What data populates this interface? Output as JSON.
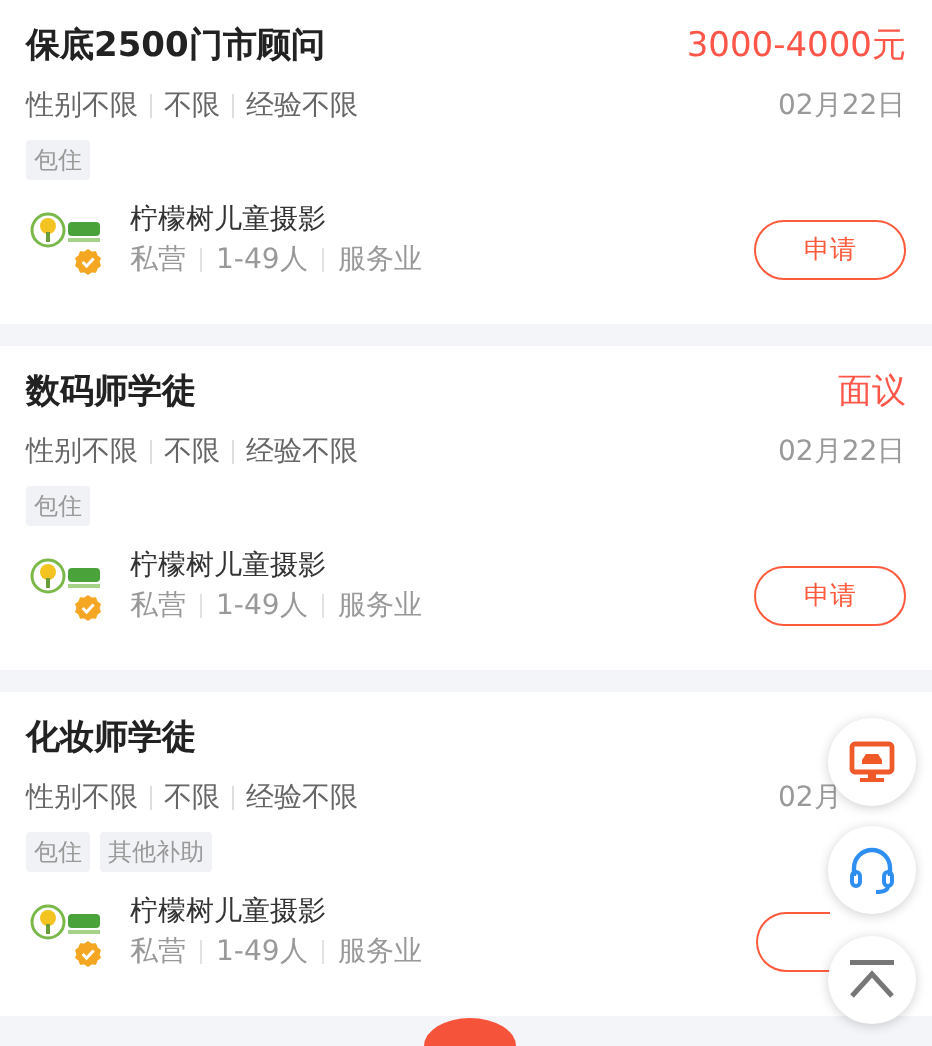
{
  "jobs": [
    {
      "title": "保底2500门市顾问",
      "salary": "3000-4000元",
      "requirements": [
        "性别不限",
        "不限",
        "经验不限"
      ],
      "date": "02月22日",
      "tags": [
        "包住"
      ],
      "company": {
        "name": "柠檬树儿童摄影",
        "facts": [
          "私营",
          "1-49人",
          "服务业"
        ],
        "verified": true
      },
      "apply": "申请"
    },
    {
      "title": "数码师学徒",
      "salary": "面议",
      "requirements": [
        "性别不限",
        "不限",
        "经验不限"
      ],
      "date": "02月22日",
      "tags": [
        "包住"
      ],
      "company": {
        "name": "柠檬树儿童摄影",
        "facts": [
          "私营",
          "1-49人",
          "服务业"
        ],
        "verified": true
      },
      "apply": "申请"
    },
    {
      "title": "化妆师学徒",
      "requirements": [
        "性别不限",
        "不限",
        "经验不限"
      ],
      "date": "02月",
      "tags": [
        "包住",
        "其他补助"
      ],
      "company": {
        "name": "柠檬树儿童摄影",
        "facts": [
          "私营",
          "1-49人",
          "服务业"
        ],
        "verified": true
      }
    }
  ]
}
